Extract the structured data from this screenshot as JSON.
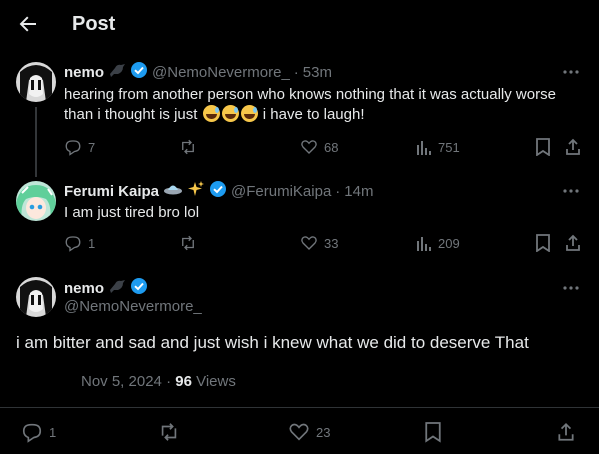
{
  "header": {
    "title": "Post"
  },
  "posts": [
    {
      "name": "nemo",
      "handle": "@NemoNevermore_",
      "dot": "·",
      "time": "53m",
      "text_before": "hearing from another person who knows nothing that it was actually worse than i thought is just",
      "text_after": "i have to laugh!",
      "replies": "7",
      "likes": "68",
      "views": "751"
    },
    {
      "name": "Ferumi Kaipa",
      "handle": "@FerumiKaipa",
      "dot": "·",
      "time": "14m",
      "text": "I am just tired bro lol",
      "replies": "1",
      "likes": "33",
      "views": "209"
    }
  ],
  "main_post": {
    "name": "nemo",
    "handle": "@NemoNevermore_",
    "text": "i am bitter and sad and just wish i knew what we did to deserve That",
    "date": "Nov 5, 2024",
    "dot": "·",
    "views_count": "96",
    "views_label": "Views",
    "replies": "1",
    "likes": "23"
  },
  "colors": {
    "background": "#000000",
    "text": "#e7e9ea",
    "muted": "#71767b",
    "verified": "#1d9bf0",
    "divider": "#2f3336"
  }
}
